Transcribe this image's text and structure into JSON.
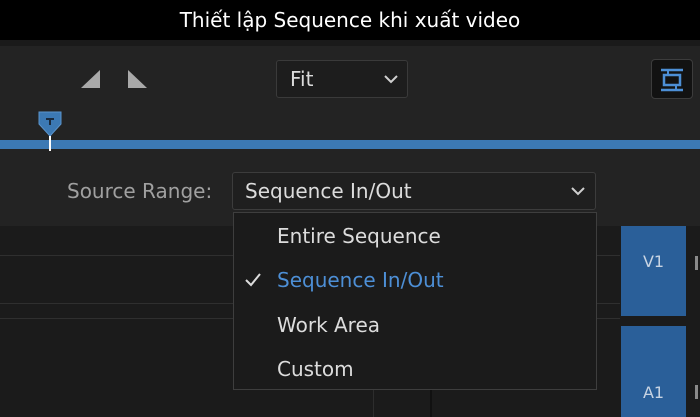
{
  "caption": "Thiết lập Sequence khi xuất video",
  "toolbar": {
    "mark_in_icon": "mark-in-triangle-icon",
    "mark_out_icon": "mark-out-triangle-icon",
    "zoom": {
      "value": "Fit"
    },
    "export_frame_icon": "export-frame-icon"
  },
  "timeline": {
    "playhead_icon": "playhead-marker-icon",
    "bar_color": "#3c79b4"
  },
  "source_range": {
    "label": "Source Range:",
    "value": "Sequence In/Out",
    "options": [
      {
        "label": "Entire Sequence",
        "selected": false
      },
      {
        "label": "Sequence In/Out",
        "selected": true
      },
      {
        "label": "Work Area",
        "selected": false
      },
      {
        "label": "Custom",
        "selected": false
      }
    ]
  },
  "tracks": [
    {
      "label": "V1"
    },
    {
      "label": "A1"
    }
  ],
  "colors": {
    "accent": "#4d8fd6",
    "track": "#2a5f99",
    "background": "#232323"
  }
}
